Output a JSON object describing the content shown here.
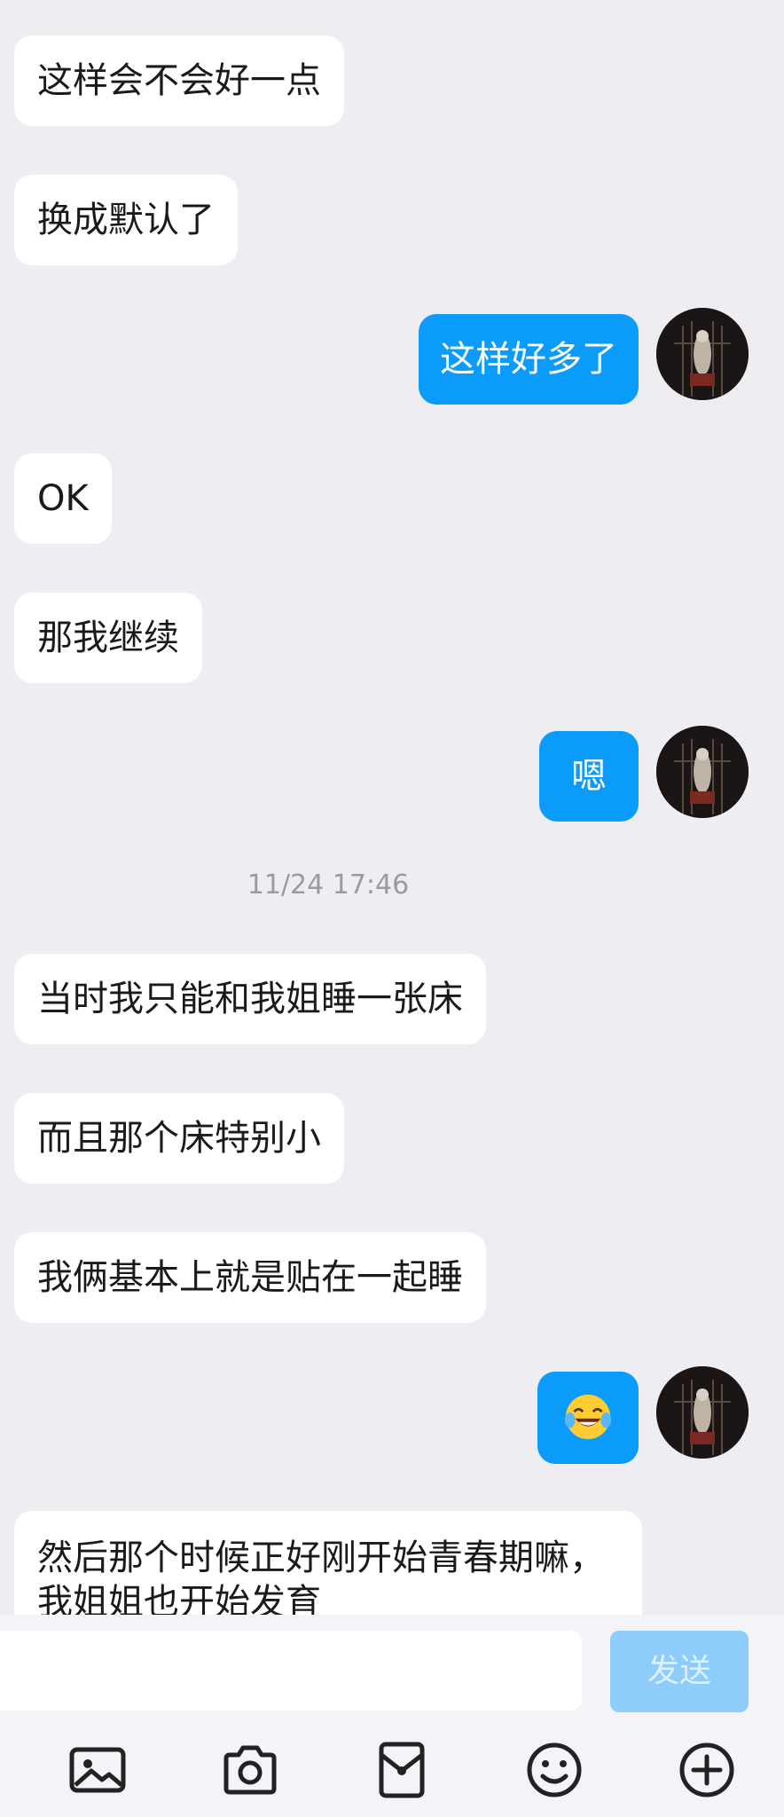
{
  "messages": [
    {
      "side": "in",
      "text": "这样会不会好一点"
    },
    {
      "side": "in",
      "text": "换成默认了"
    },
    {
      "side": "out",
      "text": "这样好多了"
    },
    {
      "side": "in",
      "text": "OK"
    },
    {
      "side": "in",
      "text": "那我继续"
    },
    {
      "side": "out",
      "text": "嗯"
    },
    {
      "timestamp": "11/24 17:46"
    },
    {
      "side": "in",
      "text": "当时我只能和我姐睡一张床"
    },
    {
      "side": "in",
      "text": "而且那个床特别小"
    },
    {
      "side": "in",
      "text": "我俩基本上就是贴在一起睡"
    },
    {
      "side": "out",
      "emoji": "tears-of-joy"
    },
    {
      "side": "in",
      "text": "然后那个时候正好刚开始青春期嘛，我姐姐也开始发育"
    }
  ],
  "input": {
    "value": "",
    "placeholder": ""
  },
  "send_label": "发送",
  "toolbar": [
    "image-icon",
    "camera-icon",
    "red-packet-icon",
    "emoji-icon",
    "add-icon"
  ],
  "colors": {
    "background": "#EDEDF2",
    "incoming_bubble": "#FFFFFF",
    "outgoing_bubble": "#0A9BFB",
    "send_button_disabled": "#8ECDFB"
  }
}
